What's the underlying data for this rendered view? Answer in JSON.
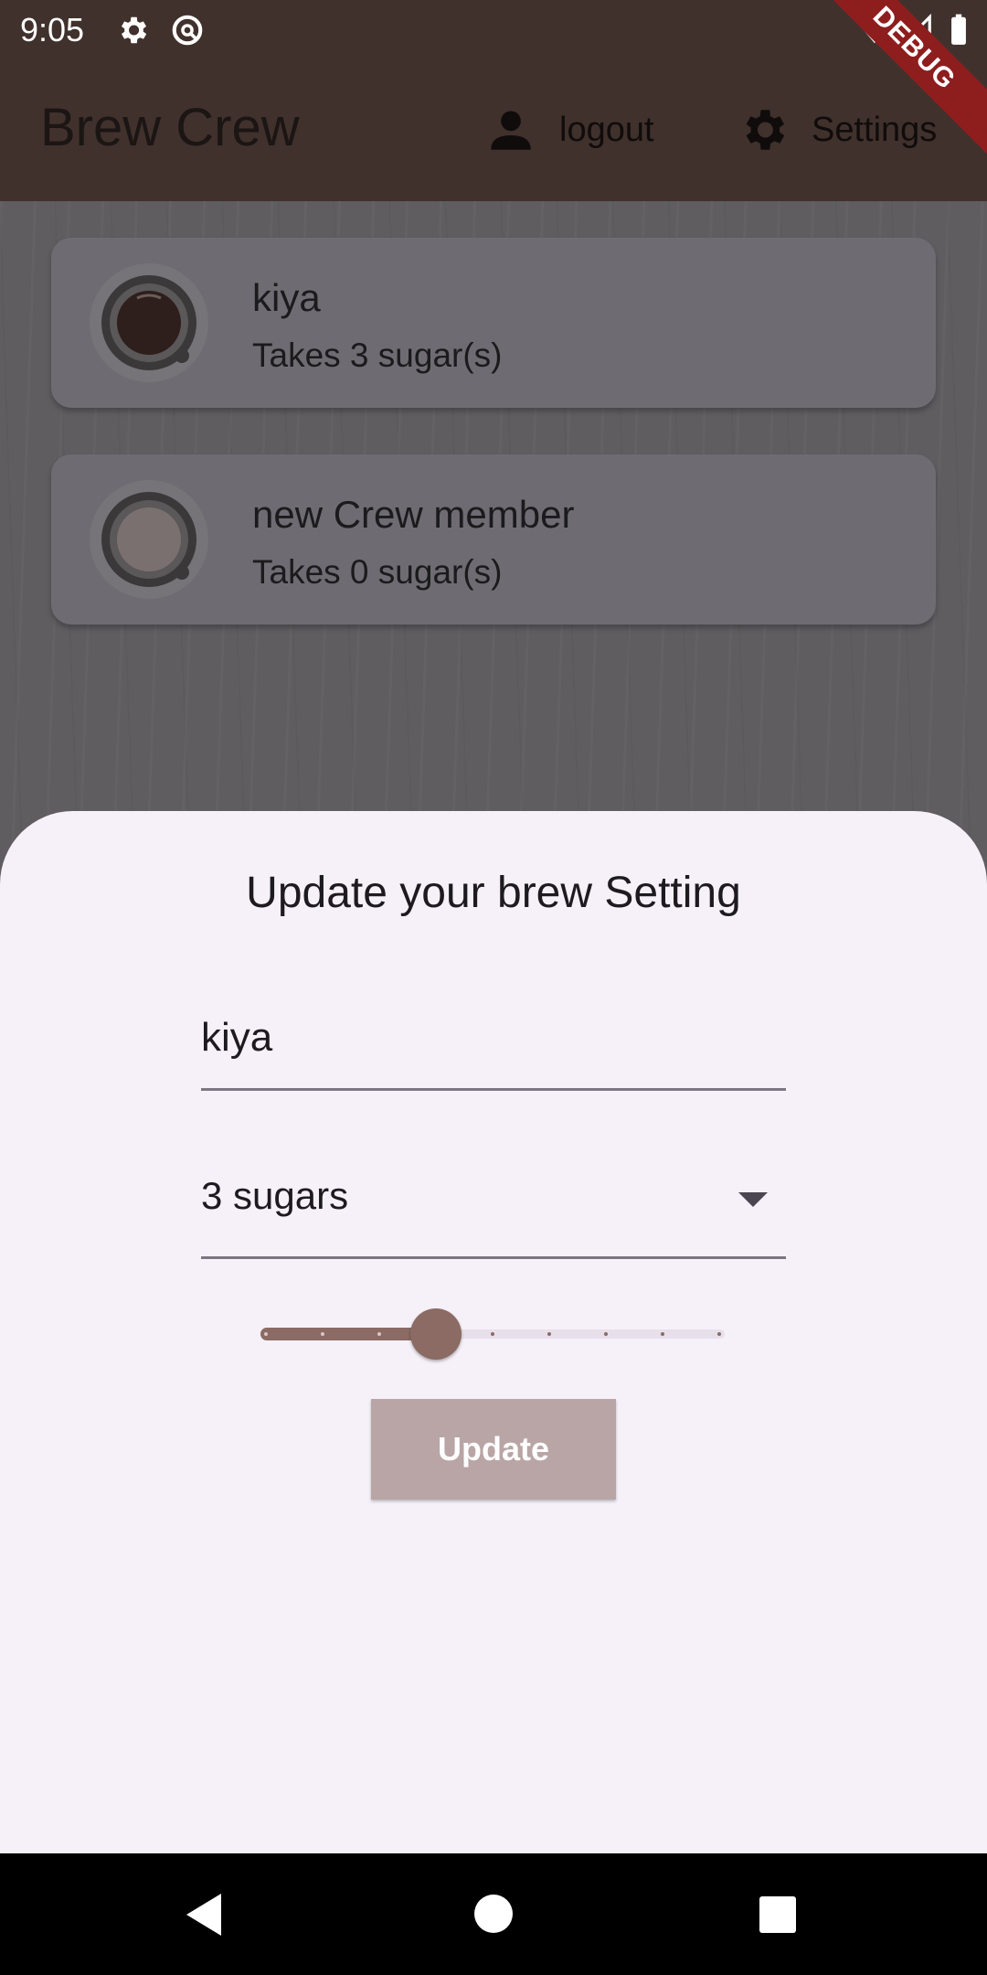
{
  "status_bar": {
    "time": "9:05"
  },
  "app_bar": {
    "title": "Brew Crew",
    "logout_label": "logout",
    "settings_label": "Settings",
    "debug_label": "DEBUG"
  },
  "crew": [
    {
      "name": "kiya",
      "sugars_text": "Takes 3 sugar(s)"
    },
    {
      "name": "new Crew member",
      "sugars_text": "Takes 0 sugar(s)"
    }
  ],
  "sheet": {
    "title": "Update your brew Setting",
    "name_value": "kiya",
    "sugars_selected": "3 sugars",
    "strength_slider": {
      "min": 100,
      "max": 900,
      "divisions": 8,
      "value": 400
    },
    "update_label": "Update"
  },
  "colors": {
    "app_bar": "#40312c",
    "accent": "#8b6b63",
    "button": "#b9a5a5",
    "sheet": "#f6f1f9"
  }
}
